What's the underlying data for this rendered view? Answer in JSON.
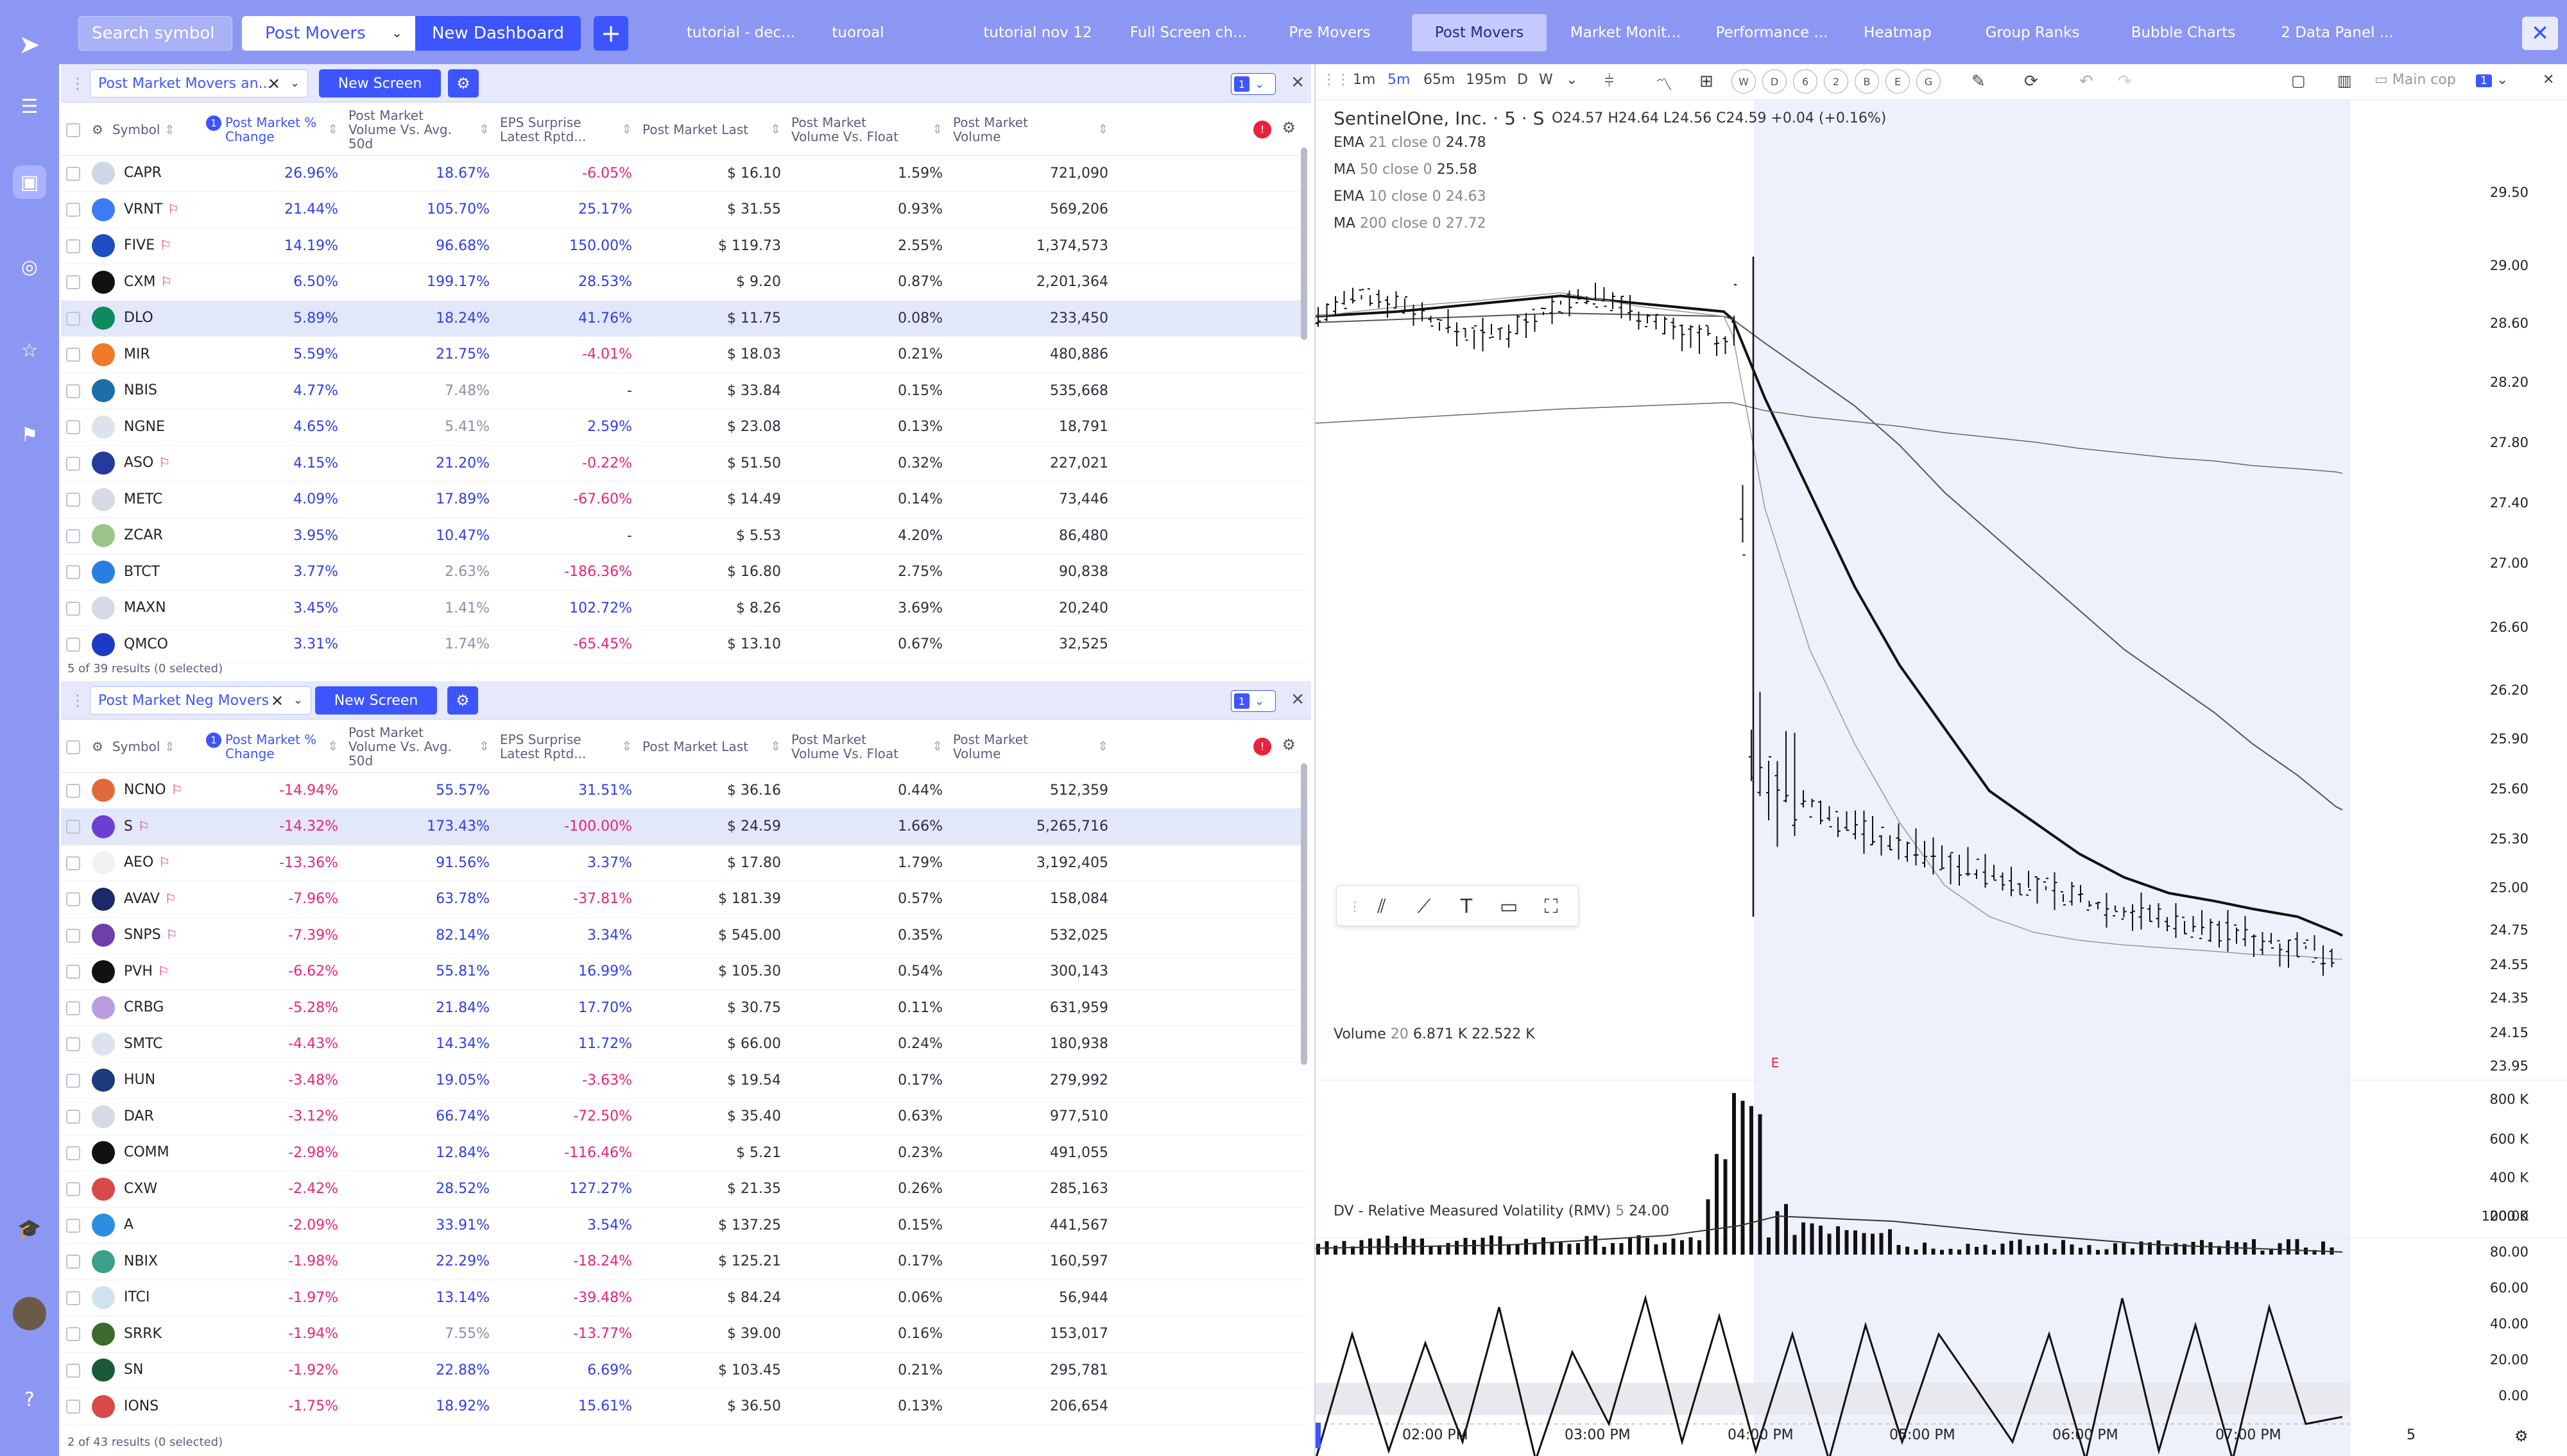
{
  "topbar": {
    "search_placeholder": "Search symbol",
    "dashboard": "Post Movers",
    "new_dashboard": "New Dashboard",
    "add": "+",
    "tabs": [
      "tutorial - dec...",
      "tuoroal",
      "tutorial nov 12",
      "Full Screen ch...",
      "Pre Movers",
      "Post Movers",
      "Market Monit...",
      "Performance ...",
      "Heatmap",
      "Group Ranks",
      "Bubble Charts",
      "2 Data Panel ..."
    ],
    "active_tab": "Post Movers",
    "close": "✕"
  },
  "panel1": {
    "screen": "Post Market Movers an...",
    "new_screen": "New Screen",
    "link": "1",
    "cols": [
      "Symbol",
      "Post Market % Change",
      "Post Market Volume Vs. Avg. 50d",
      "EPS Surprise Latest Rptd...",
      "Post Market Last",
      "Post Market Volume Vs. Float",
      "Post Market Volume"
    ],
    "sort_badge": "1",
    "rows": [
      {
        "s": "CAPR",
        "c": "26.96%",
        "v": "18.67%",
        "e": "-6.05%",
        "l": "$ 16.10",
        "f": "1.59%",
        "vol": "721,090",
        "flag": false,
        "logo": "#cfd6e6",
        "vc": "pos",
        "ec": "neg"
      },
      {
        "s": "VRNT",
        "c": "21.44%",
        "v": "105.70%",
        "e": "25.17%",
        "l": "$ 31.55",
        "f": "0.93%",
        "vol": "569,206",
        "flag": true,
        "logo": "#3b7bf5",
        "vc": "pos",
        "ec": "pos"
      },
      {
        "s": "FIVE",
        "c": "14.19%",
        "v": "96.68%",
        "e": "150.00%",
        "l": "$ 119.73",
        "f": "2.55%",
        "vol": "1,374,573",
        "flag": true,
        "logo": "#1d4fc2",
        "vc": "pos",
        "ec": "pos"
      },
      {
        "s": "CXM",
        "c": "6.50%",
        "v": "199.17%",
        "e": "28.53%",
        "l": "$ 9.20",
        "f": "0.87%",
        "vol": "2,201,364",
        "flag": true,
        "logo": "#111111",
        "vc": "pos",
        "ec": "pos"
      },
      {
        "s": "DLO",
        "c": "5.89%",
        "v": "18.24%",
        "e": "41.76%",
        "l": "$ 11.75",
        "f": "0.08%",
        "vol": "233,450",
        "flag": false,
        "logo": "#0f8a5f",
        "vc": "pos",
        "ec": "pos"
      },
      {
        "s": "MIR",
        "c": "5.59%",
        "v": "21.75%",
        "e": "-4.01%",
        "l": "$ 18.03",
        "f": "0.21%",
        "vol": "480,886",
        "flag": false,
        "logo": "#f07a2a",
        "vc": "pos",
        "ec": "neg"
      },
      {
        "s": "NBIS",
        "c": "4.77%",
        "v": "7.48%",
        "e": "-",
        "l": "$ 33.84",
        "f": "0.15%",
        "vol": "535,668",
        "flag": false,
        "logo": "#1d6fa8",
        "vc": "mut",
        "ec": "dk"
      },
      {
        "s": "NGNE",
        "c": "4.65%",
        "v": "5.41%",
        "e": "2.59%",
        "l": "$ 23.08",
        "f": "0.13%",
        "vol": "18,791",
        "flag": false,
        "logo": "#dde3ee",
        "vc": "mut",
        "ec": "pos"
      },
      {
        "s": "ASO",
        "c": "4.15%",
        "v": "21.20%",
        "e": "-0.22%",
        "l": "$ 51.50",
        "f": "0.32%",
        "vol": "227,021",
        "flag": true,
        "logo": "#243a9c",
        "vc": "pos",
        "ec": "neg"
      },
      {
        "s": "METC",
        "c": "4.09%",
        "v": "17.89%",
        "e": "-67.60%",
        "l": "$ 14.49",
        "f": "0.14%",
        "vol": "73,446",
        "flag": false,
        "logo": "#d6dae6",
        "vc": "pos",
        "ec": "neg"
      },
      {
        "s": "ZCAR",
        "c": "3.95%",
        "v": "10.47%",
        "e": "-",
        "l": "$ 5.53",
        "f": "4.20%",
        "vol": "86,480",
        "flag": false,
        "logo": "#9bc48a",
        "vc": "pos",
        "ec": "dk"
      },
      {
        "s": "BTCT",
        "c": "3.77%",
        "v": "2.63%",
        "e": "-186.36%",
        "l": "$ 16.80",
        "f": "2.75%",
        "vol": "90,838",
        "flag": false,
        "logo": "#2a7de1",
        "vc": "mut",
        "ec": "neg"
      },
      {
        "s": "MAXN",
        "c": "3.45%",
        "v": "1.41%",
        "e": "102.72%",
        "l": "$ 8.26",
        "f": "3.69%",
        "vol": "20,240",
        "flag": false,
        "logo": "#d6dae6",
        "vc": "mut",
        "ec": "pos"
      },
      {
        "s": "QMCO",
        "c": "3.31%",
        "v": "1.74%",
        "e": "-65.45%",
        "l": "$ 13.10",
        "f": "0.67%",
        "vol": "32,525",
        "flag": false,
        "logo": "#1c3ac2",
        "vc": "mut",
        "ec": "neg"
      }
    ],
    "footer": "5 of 39 results (0 selected)"
  },
  "panel2": {
    "screen": "Post Market Neg Movers",
    "new_screen": "New Screen",
    "link": "1",
    "cols": [
      "Symbol",
      "Post Market % Change",
      "Post Market Volume Vs. Avg. 50d",
      "EPS Surprise Latest Rptd...",
      "Post Market Last",
      "Post Market Volume Vs. Float",
      "Post Market Volume"
    ],
    "sort_badge": "1",
    "rows": [
      {
        "s": "NCNO",
        "c": "-14.94%",
        "v": "55.57%",
        "e": "31.51%",
        "l": "$ 36.16",
        "f": "0.44%",
        "vol": "512,359",
        "flag": true,
        "logo": "#e26a3a",
        "vc": "pos",
        "ec": "pos"
      },
      {
        "s": "S",
        "c": "-14.32%",
        "v": "173.43%",
        "e": "-100.00%",
        "l": "$ 24.59",
        "f": "1.66%",
        "vol": "5,265,716",
        "flag": true,
        "logo": "#6b3fd4",
        "vc": "pos",
        "ec": "neg"
      },
      {
        "s": "AEO",
        "c": "-13.36%",
        "v": "91.56%",
        "e": "3.37%",
        "l": "$ 17.80",
        "f": "1.79%",
        "vol": "3,192,405",
        "flag": true,
        "logo": "#f2f2f2",
        "vc": "pos",
        "ec": "pos"
      },
      {
        "s": "AVAV",
        "c": "-7.96%",
        "v": "63.78%",
        "e": "-37.81%",
        "l": "$ 181.39",
        "f": "0.57%",
        "vol": "158,084",
        "flag": true,
        "logo": "#1b2a6b",
        "vc": "pos",
        "ec": "neg"
      },
      {
        "s": "SNPS",
        "c": "-7.39%",
        "v": "82.14%",
        "e": "3.34%",
        "l": "$ 545.00",
        "f": "0.35%",
        "vol": "532,025",
        "flag": true,
        "logo": "#6d3fa8",
        "vc": "pos",
        "ec": "pos"
      },
      {
        "s": "PVH",
        "c": "-6.62%",
        "v": "55.81%",
        "e": "16.99%",
        "l": "$ 105.30",
        "f": "0.54%",
        "vol": "300,143",
        "flag": true,
        "logo": "#111111",
        "vc": "pos",
        "ec": "pos"
      },
      {
        "s": "CRBG",
        "c": "-5.28%",
        "v": "21.84%",
        "e": "17.70%",
        "l": "$ 30.75",
        "f": "0.11%",
        "vol": "631,959",
        "flag": false,
        "logo": "#b99be0",
        "vc": "pos",
        "ec": "pos"
      },
      {
        "s": "SMTC",
        "c": "-4.43%",
        "v": "14.34%",
        "e": "11.72%",
        "l": "$ 66.00",
        "f": "0.24%",
        "vol": "180,938",
        "flag": false,
        "logo": "#dde3ee",
        "vc": "pos",
        "ec": "pos"
      },
      {
        "s": "HUN",
        "c": "-3.48%",
        "v": "19.05%",
        "e": "-3.63%",
        "l": "$ 19.54",
        "f": "0.17%",
        "vol": "279,992",
        "flag": false,
        "logo": "#1d3a7a",
        "vc": "pos",
        "ec": "neg"
      },
      {
        "s": "DAR",
        "c": "-3.12%",
        "v": "66.74%",
        "e": "-72.50%",
        "l": "$ 35.40",
        "f": "0.63%",
        "vol": "977,510",
        "flag": false,
        "logo": "#d6dae6",
        "vc": "pos",
        "ec": "neg"
      },
      {
        "s": "COMM",
        "c": "-2.98%",
        "v": "12.84%",
        "e": "-116.46%",
        "l": "$ 5.21",
        "f": "0.23%",
        "vol": "491,055",
        "flag": false,
        "logo": "#111111",
        "vc": "pos",
        "ec": "neg"
      },
      {
        "s": "CXW",
        "c": "-2.42%",
        "v": "28.52%",
        "e": "127.27%",
        "l": "$ 21.35",
        "f": "0.26%",
        "vol": "285,163",
        "flag": false,
        "logo": "#d84a4a",
        "vc": "pos",
        "ec": "pos"
      },
      {
        "s": "A",
        "c": "-2.09%",
        "v": "33.91%",
        "e": "3.54%",
        "l": "$ 137.25",
        "f": "0.15%",
        "vol": "441,567",
        "flag": false,
        "logo": "#2a8fe0",
        "vc": "pos",
        "ec": "pos"
      },
      {
        "s": "NBIX",
        "c": "-1.98%",
        "v": "22.29%",
        "e": "-18.24%",
        "l": "$ 125.21",
        "f": "0.17%",
        "vol": "160,597",
        "flag": false,
        "logo": "#3aa08a",
        "vc": "pos",
        "ec": "neg"
      },
      {
        "s": "ITCI",
        "c": "-1.97%",
        "v": "13.14%",
        "e": "-39.48%",
        "l": "$ 84.24",
        "f": "0.06%",
        "vol": "56,944",
        "flag": false,
        "logo": "#cfe3ef",
        "vc": "pos",
        "ec": "neg"
      },
      {
        "s": "SRRK",
        "c": "-1.94%",
        "v": "7.55%",
        "e": "-13.77%",
        "l": "$ 39.00",
        "f": "0.16%",
        "vol": "153,017",
        "flag": false,
        "logo": "#3a6b2a",
        "vc": "mut",
        "ec": "neg"
      },
      {
        "s": "SN",
        "c": "-1.92%",
        "v": "22.88%",
        "e": "6.69%",
        "l": "$ 103.45",
        "f": "0.21%",
        "vol": "295,781",
        "flag": false,
        "logo": "#1a5a3a",
        "vc": "pos",
        "ec": "pos"
      },
      {
        "s": "IONS",
        "c": "-1.75%",
        "v": "18.92%",
        "e": "15.61%",
        "l": "$ 36.50",
        "f": "0.13%",
        "vol": "206,654",
        "flag": false,
        "logo": "#d84a4a",
        "vc": "pos",
        "ec": "pos"
      }
    ],
    "footer": "2 of 43 results (0 selected)"
  },
  "chart": {
    "toolbar": {
      "intervals": [
        "1m",
        "5m",
        "65m",
        "195m",
        "D",
        "W"
      ],
      "active": "5m",
      "periods": [
        "W",
        "D",
        "6",
        "2",
        "B",
        "E",
        "G"
      ],
      "main_label": "Main cop",
      "link": "1"
    },
    "title": "SentinelOne, Inc. · 5 · S",
    "ohlc": {
      "o": "O24.57",
      "h": "H24.64",
      "l": "L24.56",
      "c": "C24.59",
      "chg": "+0.04 (+0.16%)"
    },
    "indicators": [
      {
        "name": "EMA",
        "params": "21 close 0",
        "value": "24.78"
      },
      {
        "name": "MA",
        "params": "50 close 0",
        "value": "25.58"
      },
      {
        "name": "EMA",
        "params": "10 close 0",
        "value": "24.63"
      },
      {
        "name": "MA",
        "params": "200 close 0",
        "value": "27.72"
      }
    ],
    "price_ticks": [
      "29.50",
      "29.00",
      "28.60",
      "28.20",
      "27.80",
      "27.40",
      "27.00",
      "26.60",
      "26.20",
      "25.90",
      "25.60",
      "25.30",
      "25.00",
      "24.75",
      "24.55",
      "24.35",
      "24.15",
      "23.95"
    ],
    "volume_label": "Volume",
    "volume_params": "20",
    "volume_vals": [
      "6.871 K",
      "22.522 K"
    ],
    "vol_ticks": [
      "800 K",
      "600 K",
      "400 K",
      "200 K"
    ],
    "rmv_label": "DV - Relative Measured Volatility (RMV)",
    "rmv_params": "5",
    "rmv_value": "24.00",
    "rmv_ticks": [
      "100.00",
      "80.00",
      "60.00",
      "40.00",
      "20.00",
      "0.00"
    ],
    "time_ticks": [
      "02:00 PM",
      "03:00 PM",
      "04:00 PM",
      "05:00 PM",
      "06:00 PM",
      "07:00 PM"
    ],
    "scale_val": "5",
    "earnings_marker": "E",
    "colors": {
      "accent": "#3d55ff",
      "bg": "#8c97f4",
      "neg": "#e8247a",
      "pos": "#2e3ee8"
    }
  },
  "chart_data": [
    {
      "type": "line",
      "title": "SentinelOne, Inc. · 5 · S",
      "ylabel": "Price",
      "ylim": [
        23.95,
        29.5
      ],
      "x": [
        "13:30",
        "14:00",
        "14:30",
        "15:00",
        "15:30",
        "16:00",
        "16:05",
        "16:15",
        "16:30",
        "16:45",
        "17:00",
        "17:15",
        "17:30",
        "17:45",
        "18:00",
        "18:15",
        "18:30",
        "18:45",
        "19:00",
        "19:15",
        "19:30",
        "19:35"
      ],
      "series": [
        {
          "name": "EMA 21",
          "values": [
            28.72,
            28.75,
            28.8,
            28.85,
            28.8,
            28.75,
            28.7,
            28.2,
            27.6,
            27.0,
            26.5,
            26.1,
            25.7,
            25.5,
            25.3,
            25.15,
            25.05,
            25.0,
            24.95,
            24.9,
            24.8,
            24.78
          ]
        },
        {
          "name": "MA 50",
          "values": [
            28.68,
            28.7,
            28.72,
            28.74,
            28.73,
            28.72,
            28.7,
            28.55,
            28.35,
            28.15,
            27.9,
            27.6,
            27.35,
            27.1,
            26.85,
            26.6,
            26.4,
            26.2,
            26.0,
            25.8,
            25.6,
            25.58
          ]
        },
        {
          "name": "EMA 10",
          "values": [
            28.72,
            28.78,
            28.82,
            28.87,
            28.78,
            28.72,
            28.6,
            27.5,
            26.6,
            26.0,
            25.5,
            25.1,
            24.9,
            24.8,
            24.75,
            24.72,
            24.7,
            24.68,
            24.66,
            24.65,
            24.63,
            24.63
          ]
        },
        {
          "name": "MA 200",
          "values": [
            28.04,
            28.07,
            28.1,
            28.13,
            28.15,
            28.17,
            28.17,
            28.12,
            28.08,
            28.05,
            28.02,
            27.98,
            27.95,
            27.92,
            27.88,
            27.85,
            27.82,
            27.8,
            27.77,
            27.75,
            27.73,
            27.72
          ]
        }
      ]
    },
    {
      "type": "bar",
      "title": "Volume",
      "ylabel": "Volume",
      "ylim": [
        0,
        800000
      ]
    },
    {
      "type": "line",
      "title": "DV - Relative Measured Volatility (RMV)",
      "ylim": [
        0,
        100
      ],
      "series": [
        {
          "name": "RMV",
          "values": [
            0,
            70,
            5,
            65,
            10,
            85,
            0,
            60,
            20,
            90,
            10,
            80,
            5,
            70,
            0,
            75,
            10,
            70,
            40,
            10,
            70,
            0,
            90,
            5,
            75,
            0,
            85,
            20,
            24
          ]
        }
      ]
    }
  ]
}
